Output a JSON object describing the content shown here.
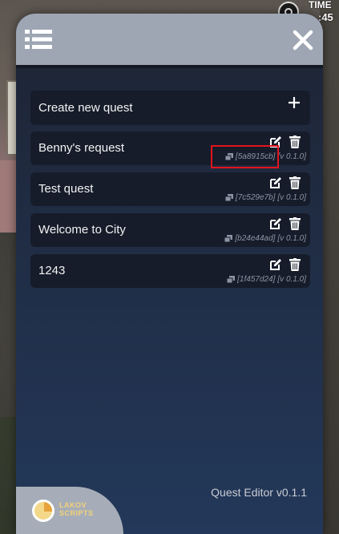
{
  "hud": {
    "time_label": "TIME",
    "clock": ":45"
  },
  "panel": {
    "create_label": "Create new quest",
    "quests": [
      {
        "title": "Benny's request",
        "id": "[5a8915cb]",
        "version": "[v 0.1.0]"
      },
      {
        "title": "Test quest",
        "id": "[7c529e7b]",
        "version": "[v 0.1.0]"
      },
      {
        "title": "Welcome to City",
        "id": "[b24e44ad]",
        "version": "[v 0.1.0]"
      },
      {
        "title": "1243",
        "id": "[1f457d24]",
        "version": "[v 0.1.0]"
      }
    ],
    "footer_version": "Quest Editor v0.1.1",
    "logo_text_line1": "LAKOV",
    "logo_text_line2": "SCRIPTS"
  },
  "colors": {
    "header": "#9ea6b4",
    "row_bg": "#161c2a",
    "highlight": "#e2141d"
  }
}
